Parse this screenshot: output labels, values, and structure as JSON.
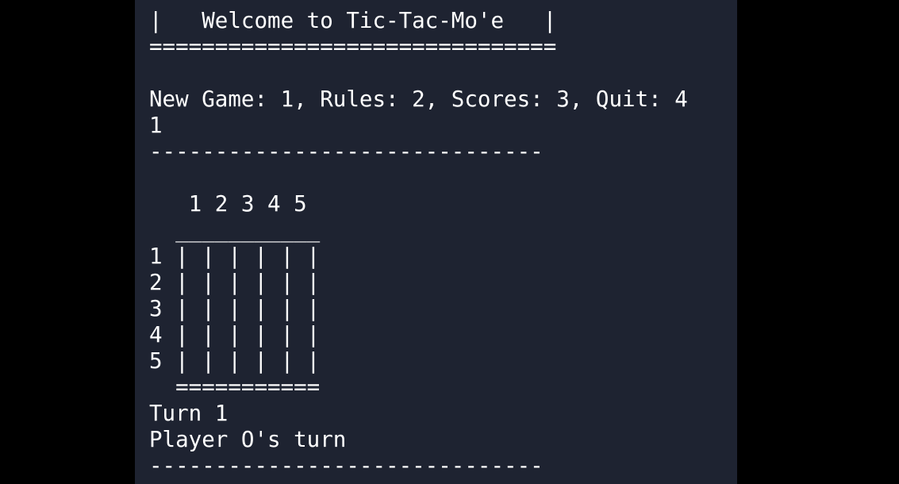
{
  "terminal": {
    "lines": [
      "===============================",
      "|   Welcome to Tic-Tac-Mo'e   |",
      "===============================",
      "New Game: 1, Rules: 2, Scores: 3, Quit: 4",
      "1",
      "------------------------------",
      "   1 2 3 4 5",
      "  ___________",
      "1 | | | | | |",
      "2 | | | | | |",
      "3 | | | | | |",
      "4 | | | | | |",
      "5 | | | | | |",
      "  ===========",
      "Turn 1",
      "Player O's turn",
      "------------------------------"
    ]
  }
}
